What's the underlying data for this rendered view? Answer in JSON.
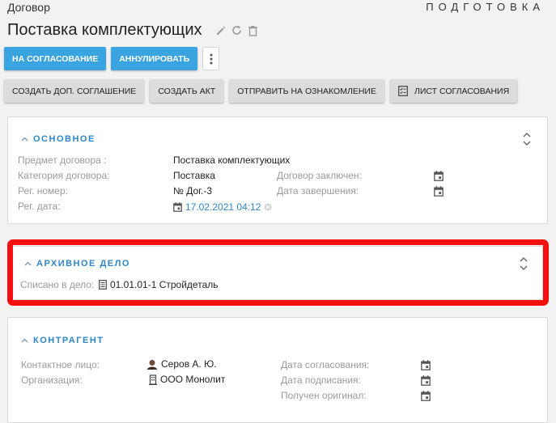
{
  "header": {
    "doc_type": "Договор",
    "status": "ПОДГОТОВКА",
    "title": "Поставка комплектующих",
    "icons": [
      "edit-icon",
      "refresh-icon",
      "trash-icon"
    ]
  },
  "toolbar": {
    "approve_label": "НА СОГЛАСОВАНИЕ",
    "cancel_label": "АННУЛИРОВАТЬ",
    "more_icon": "more-vertical-icon",
    "secondary": [
      {
        "label": "СОЗДАТЬ ДОП. СОГЛАШЕНИЕ"
      },
      {
        "label": "СОЗДАТЬ АКТ"
      },
      {
        "label": "ОТПРАВИТЬ НА ОЗНАКОМЛЕНИЕ"
      },
      {
        "label": "ЛИСТ СОГЛАСОВАНИЯ",
        "icon": "checklist-icon"
      }
    ]
  },
  "main": {
    "title": "ОСНОВНОЕ",
    "subject_label": "Предмет договора :",
    "subject_value": "Поставка комплектующих",
    "category_label": "Категория договора:",
    "category_value": "Поставка",
    "reg_number_label": "Рег. номер:",
    "reg_number_value": "№ Дог.-3",
    "reg_date_label": "Рег. дата:",
    "reg_date_value": "17.02.2021 04:12",
    "concluded_label": "Договор заключен:",
    "end_date_label": "Дата завершения:"
  },
  "archive": {
    "title": "АРХИВНОЕ ДЕЛО",
    "written_label": "Списано в дело:",
    "written_value": "01.01.01-1 Стройдеталь"
  },
  "counterparty": {
    "title": "КОНТРАГЕНТ",
    "contact_label": "Контактное лицо:",
    "contact_value": "Серов А. Ю.",
    "org_label": "Организация:",
    "org_value": "ООО Монолит",
    "agree_date_label": "Дата согласования:",
    "sign_date_label": "Дата подписания:",
    "original_label": "Получен оригинал:"
  },
  "colors": {
    "accent": "#3aa4e0",
    "section_title": "#2e86c9",
    "highlight": "#f50f0f"
  }
}
